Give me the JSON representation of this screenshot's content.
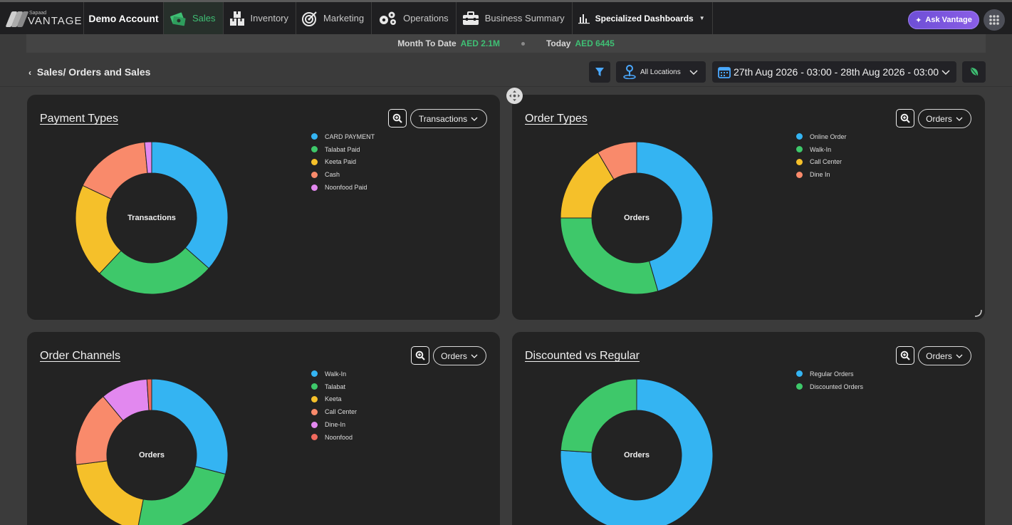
{
  "brand": {
    "small": "Sapaad",
    "big": "VANTAGE"
  },
  "account": "Demo Account",
  "nav": [
    {
      "id": "sales",
      "label": "Sales",
      "icon": "money-icon",
      "active": true
    },
    {
      "id": "inventory",
      "label": "Inventory",
      "icon": "boxes-icon"
    },
    {
      "id": "marketing",
      "label": "Marketing",
      "icon": "target-icon"
    },
    {
      "id": "operations",
      "label": "Operations",
      "icon": "gears-icon"
    },
    {
      "id": "business",
      "label": "Business Summary",
      "icon": "briefcase-icon"
    },
    {
      "id": "specialized",
      "label": "Specialized Dashboards",
      "icon": "bar-chart-icon"
    }
  ],
  "ask_label": "Ask Vantage",
  "summary": {
    "mtd_label": "Month To Date",
    "mtd_value": "AED 2.1M",
    "today_label": "Today",
    "today_value": "AED 6445"
  },
  "breadcrumb": {
    "section": "Sales/",
    "page": "Orders and Sales"
  },
  "filters": {
    "location": "All Locations",
    "date_range": "27th Aug 2026 - 03:00 - 28th Aug 2026 - 03:00"
  },
  "colors": {
    "blue": "#34b4f2",
    "green": "#3ec86a",
    "yellow": "#f5c02a",
    "salmon": "#f98a6b",
    "violet": "#e288ef",
    "red": "#f06a5e"
  },
  "charts": [
    {
      "title": "Payment Types",
      "metric": "Transactions",
      "center": "Transactions",
      "legend": [
        "CARD PAYMENT",
        "Talabat Paid",
        "Keeta Paid",
        "Cash",
        "Noonfood Paid"
      ],
      "slice_colors": [
        "#34b4f2",
        "#3ec86a",
        "#f5c02a",
        "#f98a6b",
        "#e288ef"
      ],
      "values": [
        36.5,
        25.5,
        20,
        16.5,
        1.5
      ]
    },
    {
      "title": "Order Types",
      "metric": "Orders",
      "center": "Orders",
      "legend": [
        "Online Order",
        "Walk-In",
        "Call Center",
        "Dine In"
      ],
      "slice_colors": [
        "#34b4f2",
        "#3ec86a",
        "#f5c02a",
        "#f98a6b"
      ],
      "values": [
        45.5,
        29.5,
        16.5,
        8.5
      ]
    },
    {
      "title": "Order Channels",
      "metric": "Orders",
      "center": "Orders",
      "legend": [
        "Walk-In",
        "Talabat",
        "Keeta",
        "Call Center",
        "Dine-In",
        "Noonfood"
      ],
      "slice_colors": [
        "#34b4f2",
        "#3ec86a",
        "#f5c02a",
        "#f98a6b",
        "#e288ef",
        "#f06a5e"
      ],
      "values": [
        29,
        24,
        20,
        16,
        10,
        1
      ]
    },
    {
      "title": "Discounted vs Regular",
      "metric": "Orders",
      "center": "Orders",
      "legend": [
        "Regular Orders",
        "Discounted Orders"
      ],
      "slice_colors": [
        "#34b4f2",
        "#3ec86a"
      ],
      "values": [
        76,
        24
      ]
    }
  ]
}
